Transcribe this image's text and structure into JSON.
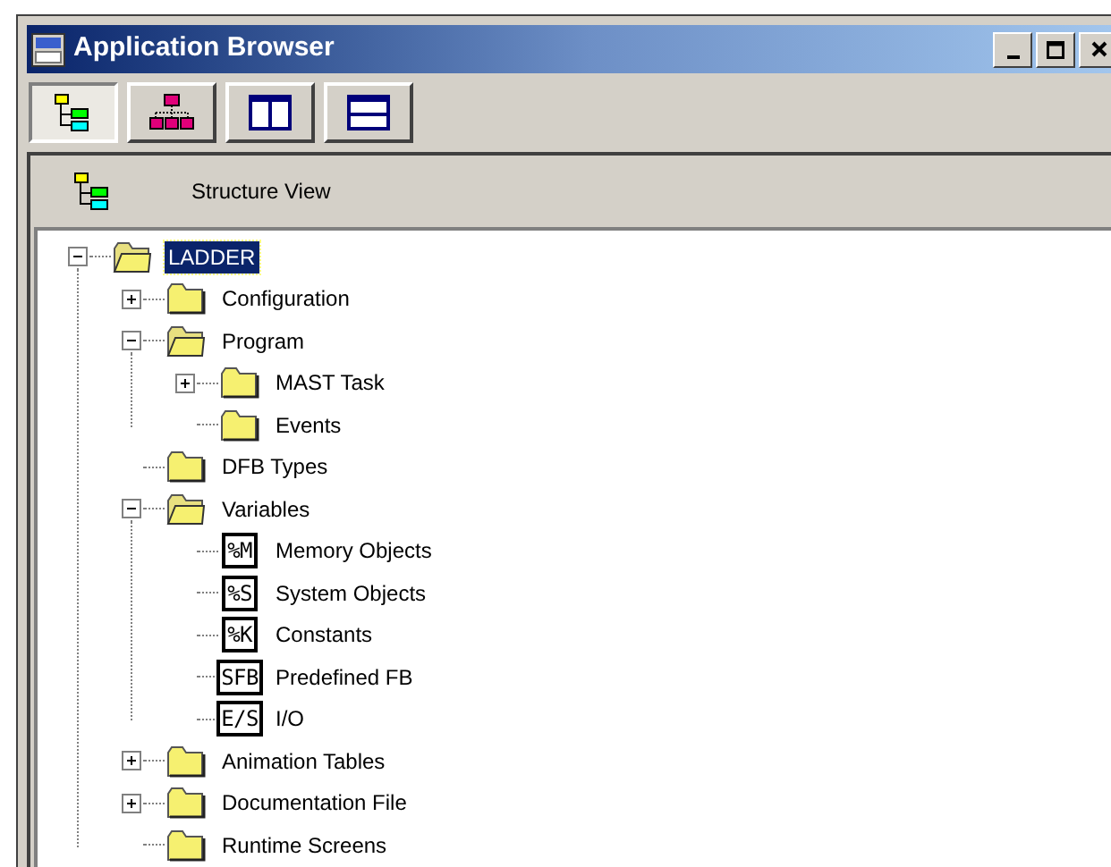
{
  "window": {
    "title": "Application Browser"
  },
  "toolbar": [
    {
      "kind": "structure",
      "selected": true
    },
    {
      "kind": "hierarchy",
      "selected": false
    },
    {
      "kind": "columns",
      "selected": false
    },
    {
      "kind": "rows",
      "selected": false
    }
  ],
  "view": {
    "title": "Structure View"
  },
  "tree": [
    {
      "label": "LADDER",
      "kind": "folder",
      "expanded": true,
      "selected": true,
      "children": [
        {
          "label": "Configuration",
          "kind": "folder",
          "expanded": false,
          "selected": false
        },
        {
          "label": "Program",
          "kind": "folder",
          "expanded": true,
          "selected": false,
          "children": [
            {
              "label": "MAST Task",
              "kind": "folder",
              "expanded": false,
              "selected": false
            },
            {
              "label": "Events",
              "kind": "leaf_folder",
              "selected": false
            }
          ]
        },
        {
          "label": "DFB Types",
          "kind": "leaf_folder",
          "selected": false
        },
        {
          "label": "Variables",
          "kind": "folder",
          "expanded": true,
          "selected": false,
          "children": [
            {
              "label": "Memory Objects",
              "kind": "object",
              "badge": "%M",
              "selected": false
            },
            {
              "label": "System Objects",
              "kind": "object",
              "badge": "%S",
              "selected": false
            },
            {
              "label": "Constants",
              "kind": "object",
              "badge": "%K",
              "selected": false
            },
            {
              "label": "Predefined FB",
              "kind": "object",
              "badge": "SFB",
              "selected": false
            },
            {
              "label": "I/O",
              "kind": "object",
              "badge": "E/S",
              "selected": false
            }
          ]
        },
        {
          "label": "Animation Tables",
          "kind": "folder",
          "expanded": false,
          "selected": false
        },
        {
          "label": "Documentation File",
          "kind": "folder",
          "expanded": false,
          "selected": false
        },
        {
          "label": "Runtime Screens",
          "kind": "leaf_folder",
          "selected": false
        }
      ]
    }
  ]
}
